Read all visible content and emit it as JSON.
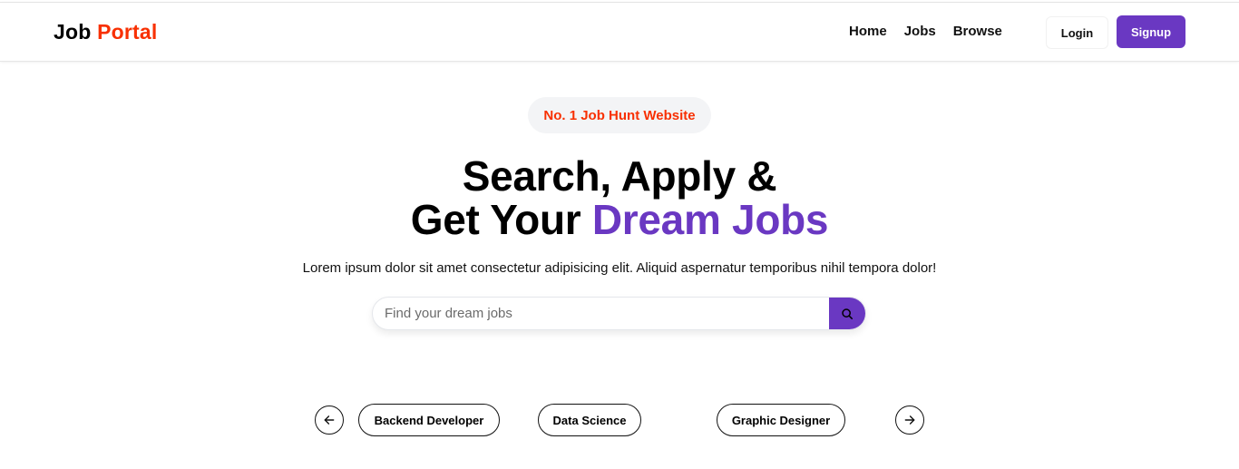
{
  "header": {
    "logo_part1": "Job",
    "logo_part2": "Portal",
    "nav": [
      "Home",
      "Jobs",
      "Browse"
    ],
    "login_label": "Login",
    "signup_label": "Signup"
  },
  "hero": {
    "badge": "No. 1 Job Hunt Website",
    "headline_line1": "Search, Apply &",
    "headline_line2_prefix": "Get Your",
    "headline_line2_accent": "Dream Jobs",
    "subtext": "Lorem ipsum dolor sit amet consectetur adipisicing elit. Aliquid aspernatur temporibus nihil tempora dolor!",
    "search_placeholder": "Find your dream jobs",
    "search_value": ""
  },
  "carousel": {
    "categories": [
      "Backend Developer",
      "Data Science",
      "Graphic Designer"
    ],
    "prev_icon": "arrow-left-icon",
    "next_icon": "arrow-right-icon"
  },
  "colors": {
    "brand_accent": "#f83002",
    "primary": "#6a38c2"
  }
}
